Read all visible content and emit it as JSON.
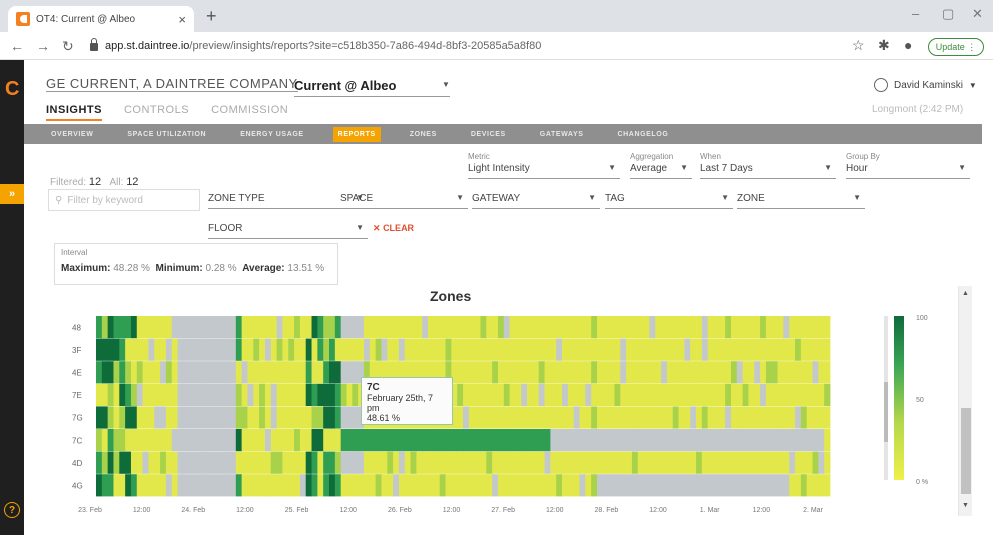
{
  "browser": {
    "tab_title": "OT4: Current @ Albeo",
    "url_host": "app.st.daintree.io",
    "url_path": "/preview/insights/reports?site=c518b350-7a86-494d-8bf3-20585a5a8f80",
    "update_label": "Update"
  },
  "app": {
    "company": "GE CURRENT, A DAINTREE COMPANY",
    "site": "Current @ Albeo",
    "user": "David Kaminski",
    "location": "Longmont (2:42 PM)",
    "top_tabs": [
      {
        "label": "INSIGHTS",
        "active": true
      },
      {
        "label": "CONTROLS",
        "active": false
      },
      {
        "label": "COMMISSION",
        "active": false
      }
    ],
    "subnav": [
      {
        "label": "OVERVIEW",
        "active": false
      },
      {
        "label": "SPACE UTILIZATION",
        "active": false
      },
      {
        "label": "ENERGY USAGE",
        "active": false
      },
      {
        "label": "REPORTS",
        "active": true
      },
      {
        "label": "ZONES",
        "active": false
      },
      {
        "label": "DEVICES",
        "active": false
      },
      {
        "label": "GATEWAYS",
        "active": false
      },
      {
        "label": "CHANGELOG",
        "active": false
      }
    ]
  },
  "filters": {
    "filtered_label": "Filtered:",
    "filtered_count": "12",
    "all_label": "All:",
    "all_count": "12",
    "search_placeholder": "Filter by keyword",
    "zone_type": "ZONE TYPE",
    "space": "SPACE",
    "gateway": "GATEWAY",
    "tag": "TAG",
    "zone": "ZONE",
    "floor": "FLOOR",
    "clear": "CLEAR",
    "metric_label": "Metric",
    "metric_value": "Light Intensity",
    "aggregation_label": "Aggregation",
    "aggregation_value": "Average",
    "when_label": "When",
    "when_value": "Last 7 Days",
    "group_label": "Group By",
    "group_value": "Hour"
  },
  "stats": {
    "title": "Interval",
    "max_label": "Maximum:",
    "max_value": "48.28 %",
    "min_label": "Minimum:",
    "min_value": "0.28 %",
    "avg_label": "Average:",
    "avg_value": "13.51 %"
  },
  "tooltip": {
    "zone": "7C",
    "time": "February 25th, 7 pm",
    "value": "48.61 %"
  },
  "chart_data": {
    "type": "heatmap",
    "title": "Zones",
    "rows": [
      "48",
      "3F",
      "4E",
      "7E",
      "7G",
      "7C",
      "4D",
      "4G"
    ],
    "x_ticks": [
      "23. Feb",
      "12:00",
      "24. Feb",
      "12:00",
      "25. Feb",
      "12:00",
      "26. Feb",
      "12:00",
      "27. Feb",
      "12:00",
      "28. Feb",
      "12:00",
      "1. Mar",
      "12:00",
      "2. Mar"
    ],
    "colorbar_ticks": [
      "100",
      "50",
      "0 %"
    ],
    "colors": {
      "missing": "#c3c8cc",
      "low": "#e3e84a",
      "mid": "#a8d24a",
      "high": "#2f9e52",
      "max": "#0e6b3a"
    }
  }
}
